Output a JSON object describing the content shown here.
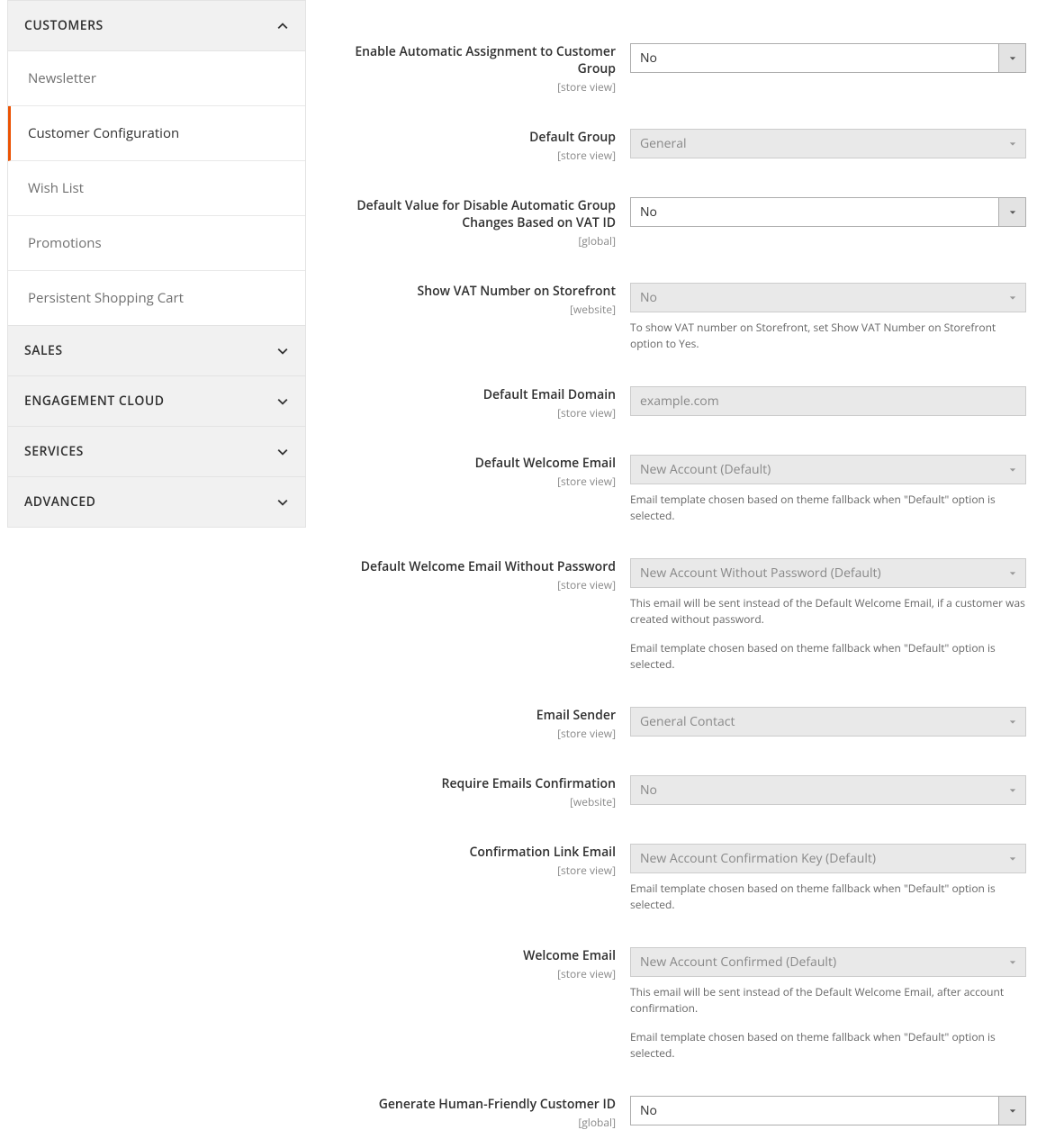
{
  "sidebar": {
    "sections": [
      {
        "label": "CUSTOMERS",
        "expanded": true,
        "items": [
          {
            "label": "Newsletter"
          },
          {
            "label": "Customer Configuration",
            "active": true
          },
          {
            "label": "Wish List"
          },
          {
            "label": "Promotions"
          },
          {
            "label": "Persistent Shopping Cart"
          }
        ]
      },
      {
        "label": "SALES",
        "expanded": false
      },
      {
        "label": "ENGAGEMENT CLOUD",
        "expanded": false
      },
      {
        "label": "SERVICES",
        "expanded": false
      },
      {
        "label": "ADVANCED",
        "expanded": false
      }
    ]
  },
  "scopes": {
    "store_view": "[store view]",
    "global": "[global]",
    "website": "[website]"
  },
  "fields": {
    "auto_assign": {
      "label": "Enable Automatic Assignment to Customer Group",
      "scope": "[store view]",
      "value": "No",
      "disabled": false
    },
    "default_group": {
      "label": "Default Group",
      "scope": "[store view]",
      "value": "General",
      "disabled": true
    },
    "default_disable_vat": {
      "label": "Default Value for Disable Automatic Group Changes Based on VAT ID",
      "scope": "[global]",
      "value": "No",
      "disabled": false
    },
    "show_vat": {
      "label": "Show VAT Number on Storefront",
      "scope": "[website]",
      "value": "No",
      "disabled": true,
      "note": "To show VAT number on Storefront, set Show VAT Number on Storefront option to Yes."
    },
    "email_domain": {
      "label": "Default Email Domain",
      "scope": "[store view]",
      "value": "example.com",
      "disabled": true
    },
    "welcome_email": {
      "label": "Default Welcome Email",
      "scope": "[store view]",
      "value": "New Account (Default)",
      "disabled": true,
      "note": "Email template chosen based on theme fallback when \"Default\" option is selected."
    },
    "welcome_no_pw": {
      "label": "Default Welcome Email Without Password",
      "scope": "[store view]",
      "value": "New Account Without Password (Default)",
      "disabled": true,
      "note1": "This email will be sent instead of the Default Welcome Email, if a customer was created without password.",
      "note2": "Email template chosen based on theme fallback when \"Default\" option is selected."
    },
    "email_sender": {
      "label": "Email Sender",
      "scope": "[store view]",
      "value": "General Contact",
      "disabled": true
    },
    "require_confirm": {
      "label": "Require Emails Confirmation",
      "scope": "[website]",
      "value": "No",
      "disabled": true
    },
    "confirm_link": {
      "label": "Confirmation Link Email",
      "scope": "[store view]",
      "value": "New Account Confirmation Key (Default)",
      "disabled": true,
      "note": "Email template chosen based on theme fallback when \"Default\" option is selected."
    },
    "welcome_confirmed": {
      "label": "Welcome Email",
      "scope": "[store view]",
      "value": "New Account Confirmed (Default)",
      "disabled": true,
      "note1": "This email will be sent instead of the Default Welcome Email, after account confirmation.",
      "note2": "Email template chosen based on theme fallback when \"Default\" option is selected."
    },
    "human_id": {
      "label": "Generate Human-Friendly Customer ID",
      "scope": "[global]",
      "value": "No",
      "disabled": false
    }
  }
}
